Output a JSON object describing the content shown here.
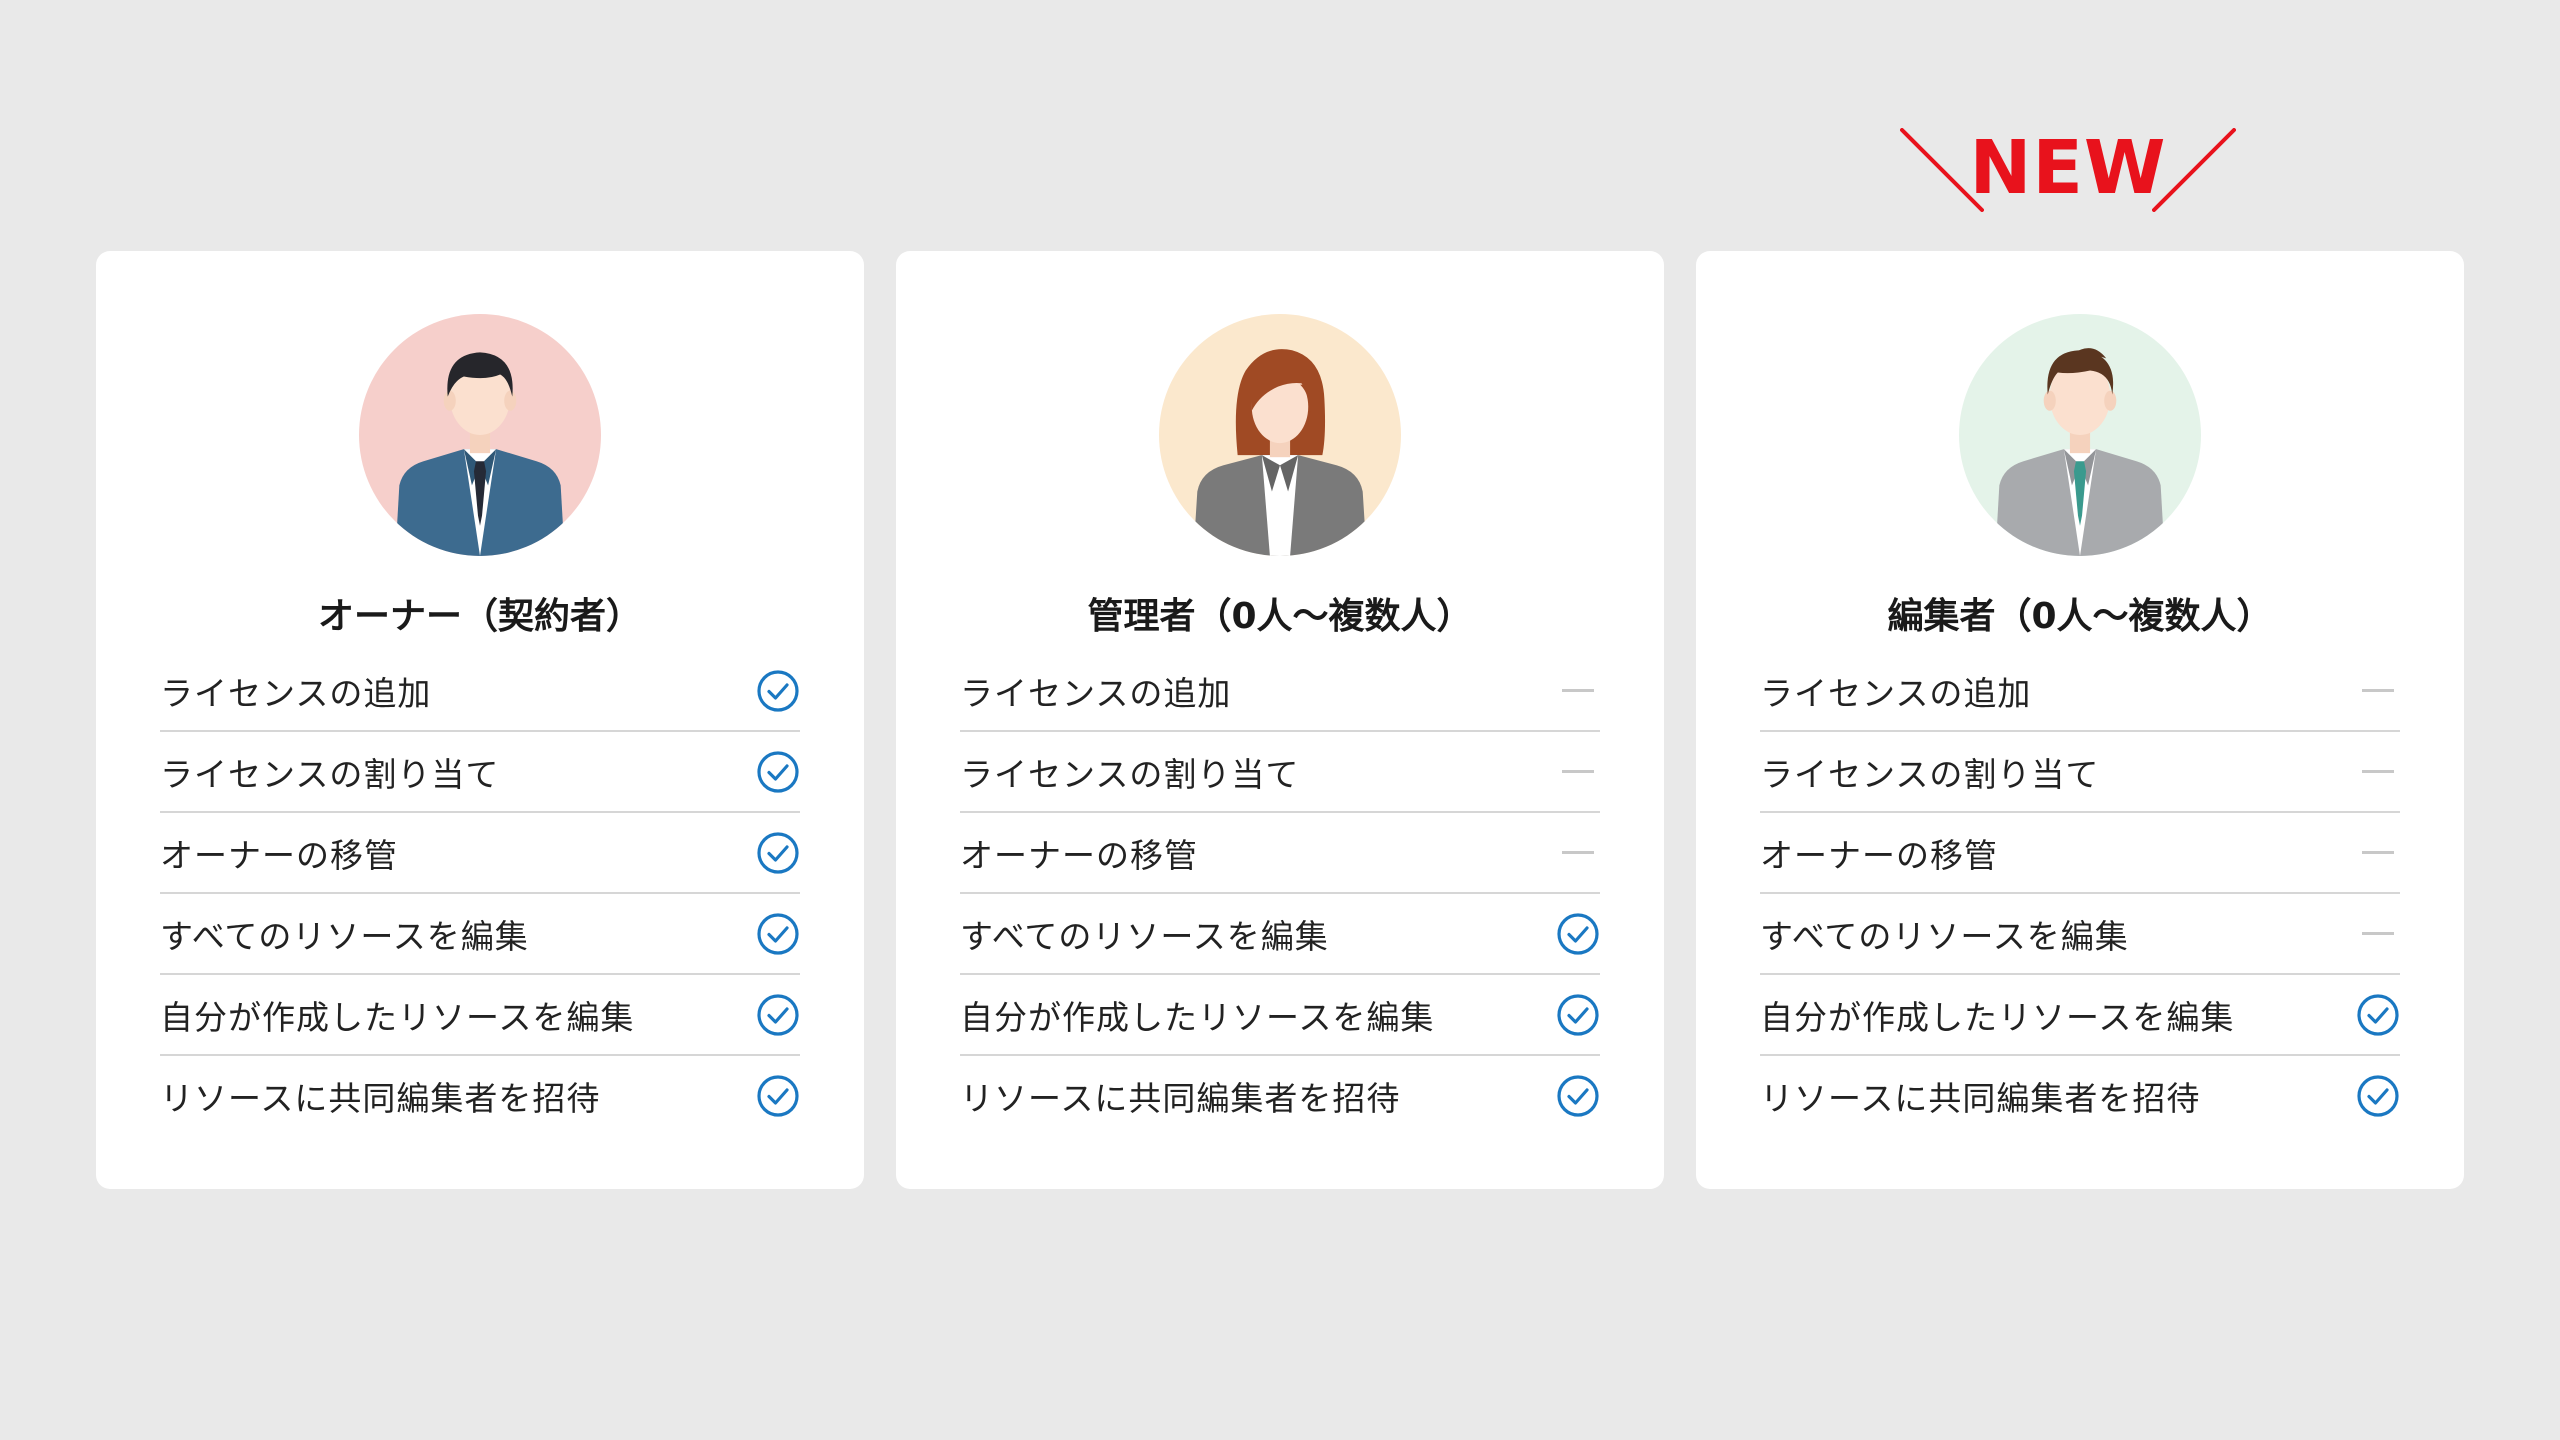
{
  "badge": {
    "text": "NEW"
  },
  "colors": {
    "background": "#e9e9e9",
    "card": "#ffffff",
    "check": "#1a78c2",
    "dash": "#c8c8c8",
    "new": "#e8121c"
  },
  "roles": [
    {
      "title": "オーナー（契約者）",
      "avatar": "businessman-avatar",
      "items": [
        {
          "label": "ライセンスの追加",
          "status": "check"
        },
        {
          "label": "ライセンスの割り当て",
          "status": "check"
        },
        {
          "label": "オーナーの移管",
          "status": "check"
        },
        {
          "label": "すべてのリソースを編集",
          "status": "check"
        },
        {
          "label": "自分が作成したリソースを編集",
          "status": "check"
        },
        {
          "label": "リソースに共同編集者を招待",
          "status": "check"
        }
      ]
    },
    {
      "title": "管理者（0人〜複数人）",
      "avatar": "businesswoman-avatar",
      "items": [
        {
          "label": "ライセンスの追加",
          "status": "dash"
        },
        {
          "label": "ライセンスの割り当て",
          "status": "dash"
        },
        {
          "label": "オーナーの移管",
          "status": "dash"
        },
        {
          "label": "すべてのリソースを編集",
          "status": "check"
        },
        {
          "label": "自分が作成したリソースを編集",
          "status": "check"
        },
        {
          "label": "リソースに共同編集者を招待",
          "status": "check"
        }
      ]
    },
    {
      "title": "編集者（0人〜複数人）",
      "avatar": "businessman-gray-suit-avatar",
      "items": [
        {
          "label": "ライセンスの追加",
          "status": "dash"
        },
        {
          "label": "ライセンスの割り当て",
          "status": "dash"
        },
        {
          "label": "オーナーの移管",
          "status": "dash"
        },
        {
          "label": "すべてのリソースを編集",
          "status": "dash"
        },
        {
          "label": "自分が作成したリソースを編集",
          "status": "check"
        },
        {
          "label": "リソースに共同編集者を招待",
          "status": "check"
        }
      ]
    }
  ]
}
